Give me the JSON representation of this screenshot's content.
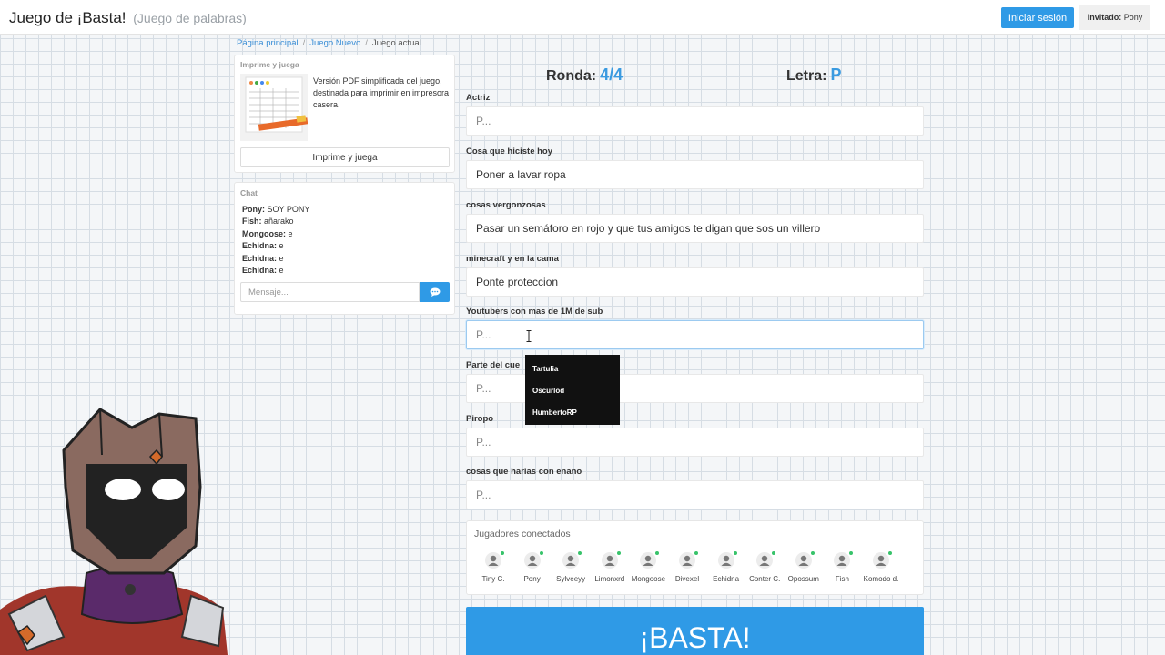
{
  "header": {
    "title": "Juego de ¡Basta!",
    "subtitle": "(Juego de palabras)",
    "login_label": "Iniciar sesión",
    "guest_label": "Invitado:",
    "guest_name": "Pony"
  },
  "breadcrumb": [
    "Página principal",
    "Juego Nuevo",
    "Juego actual"
  ],
  "print_panel": {
    "title": "Imprime y juega",
    "description": "Versión PDF simplificada del juego, destinada para imprimir en impresora casera.",
    "button_label": "Imprime y juega"
  },
  "chat": {
    "title": "Chat",
    "messages": [
      {
        "user": "Pony:",
        "text": " SOY PONY"
      },
      {
        "user": "Fish:",
        "text": " añarako"
      },
      {
        "user": "Mongoose:",
        "text": " e"
      },
      {
        "user": "Echidna:",
        "text": " e"
      },
      {
        "user": "Echidna:",
        "text": " e"
      },
      {
        "user": "Echidna:",
        "text": " e"
      }
    ],
    "input_placeholder": "Mensaje..."
  },
  "game": {
    "round_label": "Ronda:",
    "round_value": "4/4",
    "letter_label": "Letra:",
    "letter_value": "P"
  },
  "fields": [
    {
      "label": "Actriz",
      "value": "",
      "placeholder": "P..."
    },
    {
      "label": "Cosa que hiciste hoy",
      "value": "Poner a lavar ropa",
      "placeholder": "P..."
    },
    {
      "label": "cosas vergonzosas",
      "value": "Pasar un semáforo en rojo y que tus amigos te digan que sos un villero",
      "placeholder": "P..."
    },
    {
      "label": "minecraft y en la cama",
      "value": "Ponte proteccion",
      "placeholder": "P..."
    },
    {
      "label": "Youtubers con mas de 1M de sub",
      "value": "",
      "placeholder": "P..."
    },
    {
      "label": "Parte del cue",
      "value": "",
      "placeholder": "P..."
    },
    {
      "label": "Piropo",
      "value": "",
      "placeholder": "P..."
    },
    {
      "label": "cosas que harias con enano",
      "value": "",
      "placeholder": "P..."
    }
  ],
  "autocomplete": [
    "Tartulia",
    "Oscurlod",
    "HumbertoRP"
  ],
  "players_panel": {
    "title": "Jugadores conectados",
    "players": [
      "Tiny C.",
      "Pony",
      "Sylveeyy",
      "Limonxrd",
      "Mongoose",
      "Divexel",
      "Echidna",
      "Conter C.",
      "Opossum",
      "Fish",
      "Komodo d."
    ]
  },
  "basta_label": "¡BASTA!",
  "colors": {
    "accent": "#2f9ae6",
    "online": "#37c36a",
    "round_value": "#3a9ae0"
  },
  "icons": {
    "chat_send": "speech-bubble-icon",
    "player": "user-icon",
    "online": "green-dot"
  }
}
